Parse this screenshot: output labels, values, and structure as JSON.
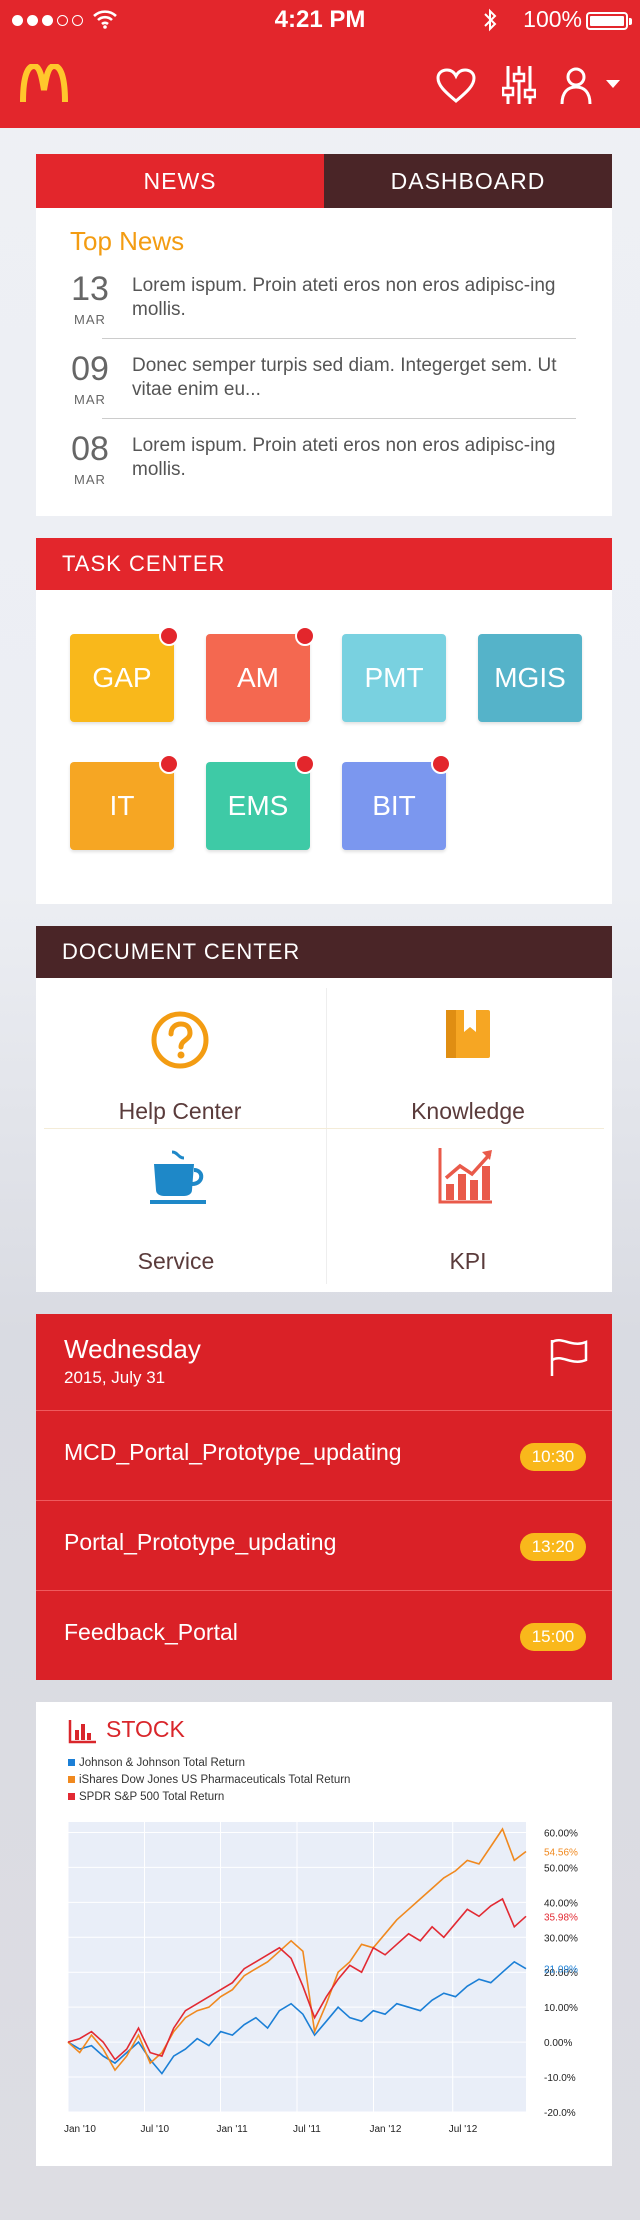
{
  "status": {
    "time": "4:21 PM",
    "battery": "100%"
  },
  "header": {
    "logo_icon": "mcdonalds-logo",
    "icons": [
      "heart-icon",
      "sliders-icon",
      "user-icon"
    ]
  },
  "news": {
    "tabs": [
      "NEWS",
      "DASHBOARD"
    ],
    "section_title": "Top News",
    "items": [
      {
        "day": "13",
        "month": "MAR",
        "text": "Lorem ispum. Proin ateti eros non eros adipisc-ing mollis."
      },
      {
        "day": "09",
        "month": "MAR",
        "text": "Donec semper turpis sed diam. Integerget sem. Ut vitae enim eu..."
      },
      {
        "day": "08",
        "month": "MAR",
        "text": "Lorem ispum. Proin ateti eros non eros adipisc-ing mollis."
      }
    ]
  },
  "tasks": {
    "title": "TASK CENTER",
    "items": [
      {
        "label": "GAP",
        "color": "#f9b81b",
        "badge": true
      },
      {
        "label": "AM",
        "color": "#f46850",
        "badge": true
      },
      {
        "label": "PMT",
        "color": "#79d1e0",
        "badge": false
      },
      {
        "label": "MGIS",
        "color": "#55b3c9",
        "badge": false
      },
      {
        "label": "IT",
        "color": "#f6a623",
        "badge": true
      },
      {
        "label": "EMS",
        "color": "#3ecaa6",
        "badge": true
      },
      {
        "label": "BIT",
        "color": "#7b97ef",
        "badge": true
      }
    ]
  },
  "documents": {
    "title": "DOCUMENT CENTER",
    "items": [
      {
        "label": "Help Center",
        "icon": "help-icon"
      },
      {
        "label": "Knowledge",
        "icon": "book-icon"
      },
      {
        "label": "Service",
        "icon": "coffee-cup-icon"
      },
      {
        "label": "KPI",
        "icon": "kpi-chart-icon"
      }
    ]
  },
  "schedule": {
    "weekday": "Wednesday",
    "date": "2015, July 31",
    "items": [
      {
        "title": "MCD_Portal_Prototype_updating",
        "time": "10:30"
      },
      {
        "title": "Portal_Prototype_updating",
        "time": "13:20"
      },
      {
        "title": "Feedback_Portal",
        "time": "15:00"
      }
    ]
  },
  "stock": {
    "title": "STOCK",
    "legend": [
      {
        "name": "Johnson & Johnson Total Return",
        "color": "#1b7fd6"
      },
      {
        "name": "iShares Dow Jones US Pharmaceuticals Total Return",
        "color": "#f0891f"
      },
      {
        "name": "SPDR S&P 500 Total Return",
        "color": "#e22a33"
      }
    ]
  },
  "chart_data": {
    "type": "line",
    "x_ticks": [
      "Jan '10",
      "Jul '10",
      "Jan '11",
      "Jul '11",
      "Jan '12",
      "Jul '12"
    ],
    "y_ticks": [
      "60.00%",
      "50.00%",
      "40.00%",
      "30.00%",
      "20.00%",
      "10.00%",
      "0.00%",
      "-10.0%",
      "-20.0%"
    ],
    "ylim": [
      -20,
      63
    ],
    "grid": true,
    "series": [
      {
        "name": "Johnson & Johnson Total Return",
        "color": "#1b7fd6",
        "end_label": "21.09%",
        "values": [
          0,
          -2,
          -1,
          -4,
          -6,
          -3,
          0,
          -5,
          -9,
          -4,
          -2,
          1,
          -1,
          3,
          2,
          5,
          7,
          4,
          9,
          11,
          8,
          2,
          6,
          10,
          7,
          6,
          9,
          8,
          11,
          10,
          9,
          12,
          14,
          13,
          16,
          18,
          17,
          20,
          23,
          21
        ]
      },
      {
        "name": "iShares Dow Jones US Pharmaceuticals Total Return",
        "color": "#f0891f",
        "end_label": "54.56%",
        "values": [
          0,
          -3,
          2,
          -2,
          -8,
          -4,
          2,
          -6,
          -3,
          3,
          7,
          9,
          10,
          13,
          15,
          19,
          21,
          23,
          26,
          29,
          26,
          3,
          11,
          20,
          23,
          28,
          27,
          31,
          35,
          38,
          41,
          44,
          47,
          49,
          52,
          51,
          56,
          61,
          52,
          54.56
        ]
      },
      {
        "name": "SPDR S&P 500 Total Return",
        "color": "#e22a33",
        "end_label": "35.98%",
        "values": [
          0,
          1,
          3,
          0,
          -5,
          -2,
          4,
          -3,
          -4,
          4,
          9,
          11,
          13,
          15,
          17,
          21,
          23,
          25,
          27,
          24,
          16,
          7,
          13,
          18,
          22,
          20,
          27,
          25,
          28,
          31,
          29,
          33,
          30,
          34,
          38,
          36,
          39,
          41,
          33,
          36
        ]
      }
    ]
  }
}
